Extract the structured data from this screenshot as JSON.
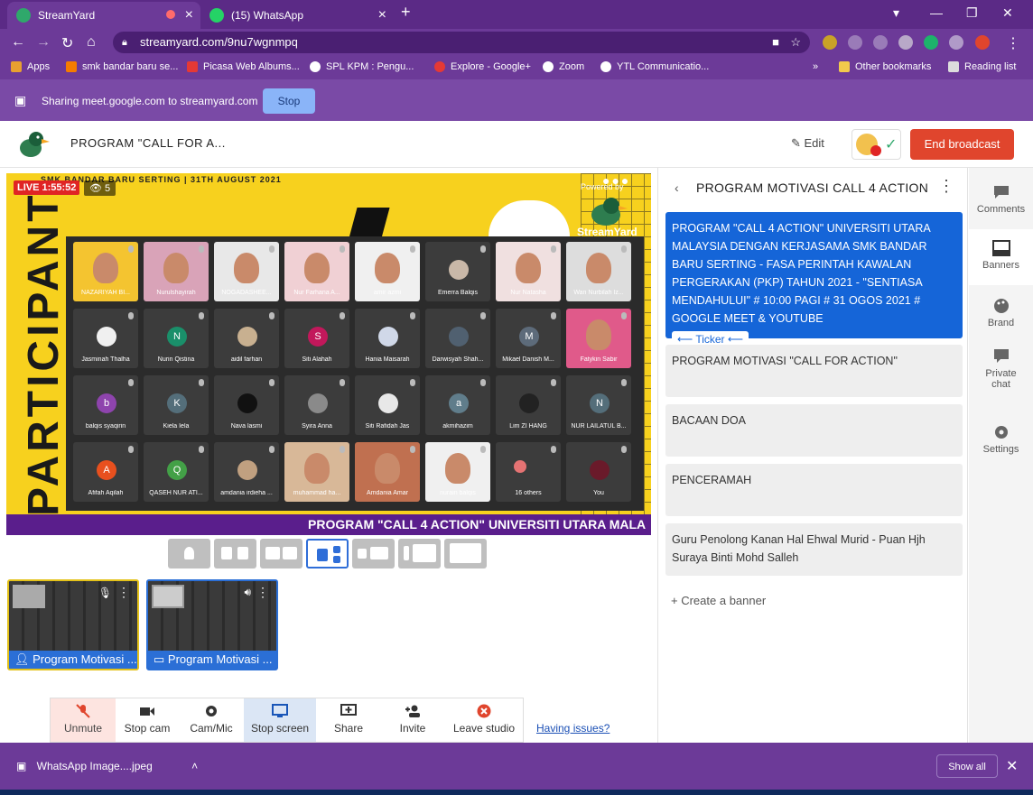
{
  "browser": {
    "tabs": [
      {
        "title": "StreamYard",
        "active": true
      },
      {
        "title": "(15) WhatsApp",
        "active": false
      }
    ],
    "url": "streamyard.com/9nu7wgnmpq",
    "bookmarks": [
      "Apps",
      "smk bandar baru se...",
      "Picasa Web Albums...",
      "SPL KPM : Pengu...",
      "Explore - Google+",
      "Zoom",
      "YTL Communicatio...",
      "»",
      "Other bookmarks",
      "Reading list"
    ],
    "sharing_text": "Sharing meet.google.com to streamyard.com",
    "stop_label": "Stop"
  },
  "header": {
    "title": "PROGRAM \"CALL FOR A...",
    "edit_label": "Edit",
    "end_broadcast_label": "End broadcast"
  },
  "stage": {
    "top_line": "SMK BANDAR BARU SERTING | 31TH AUGUST 2021",
    "live_label": "LIVE 1:55:52",
    "viewers": "5",
    "participant_text": "PARTICIPANT",
    "powered_by": "Powered by",
    "streamyard_label": "StreamYard",
    "ticker_text": "PROGRAM \"CALL 4 ACTION\" UNIVERSITI UTARA MALA",
    "tiles": [
      {
        "name": "NAZARIYAH BI...",
        "kind": "face",
        "color": "#f4c430"
      },
      {
        "name": "Nurulshayirah",
        "kind": "face",
        "color": "#d9a3b8"
      },
      {
        "name": "NOGADASHEE...",
        "kind": "face",
        "color": "#e8e8e8"
      },
      {
        "name": "Nur Farhana A...",
        "kind": "face",
        "color": "#f0d0d4"
      },
      {
        "name": "amir azmi",
        "kind": "face",
        "color": "#f0f0f0"
      },
      {
        "name": "Emerra Balqis",
        "kind": "photo",
        "color": "#c9b8a8"
      },
      {
        "name": "Nur Natasha",
        "kind": "face",
        "color": "#f0e0e0"
      },
      {
        "name": "Wan Nurbilah Iz...",
        "kind": "face",
        "color": "#dddddd"
      },
      {
        "name": "Jasminah Thalha",
        "kind": "photo",
        "color": "#f0f0f0"
      },
      {
        "name": "Nurin Qistina",
        "kind": "letter",
        "letter": "N",
        "color": "#1a8f6a"
      },
      {
        "name": "aidil farhan",
        "kind": "photo",
        "color": "#c8b090"
      },
      {
        "name": "Siti Alahah",
        "kind": "letter",
        "letter": "S",
        "color": "#c2185b"
      },
      {
        "name": "Hania Maisarah",
        "kind": "photo",
        "color": "#d0d8e8"
      },
      {
        "name": "Darwisyah Shah...",
        "kind": "photo",
        "color": "#506070"
      },
      {
        "name": "Mikael Danish M...",
        "kind": "letter",
        "letter": "M",
        "color": "#5d6b7a"
      },
      {
        "name": "Fatykin Sabir",
        "kind": "face",
        "color": "#e05a8a"
      },
      {
        "name": "balqis syaqirin",
        "kind": "letter",
        "letter": "b",
        "color": "#8e44ad"
      },
      {
        "name": "Kiela Iela",
        "kind": "letter",
        "letter": "K",
        "color": "#546e7a"
      },
      {
        "name": "Nava lasmi",
        "kind": "photo",
        "color": "#111111"
      },
      {
        "name": "Syira Anna",
        "kind": "photo",
        "color": "#8a8a8a"
      },
      {
        "name": "Siti Rafidah Jas",
        "kind": "photo",
        "color": "#e8e8e8"
      },
      {
        "name": "akmihazim",
        "kind": "letter",
        "letter": "a",
        "color": "#607d8b"
      },
      {
        "name": "Lim ZI HANG",
        "kind": "photo",
        "color": "#222222"
      },
      {
        "name": "NUR LAILATUL B...",
        "kind": "letter",
        "letter": "N",
        "color": "#546e7a"
      },
      {
        "name": "Afifah Aqilah",
        "kind": "letter",
        "letter": "A",
        "color": "#e8501e"
      },
      {
        "name": "QASEH NUR ATI...",
        "kind": "letter",
        "letter": "Q",
        "color": "#43a047"
      },
      {
        "name": "amdania irdieha ...",
        "kind": "photo",
        "color": "#c0a080"
      },
      {
        "name": "muhammad ha...",
        "kind": "face",
        "color": "#d8b898"
      },
      {
        "name": "Amdania Amar",
        "kind": "face",
        "color": "#c07050"
      },
      {
        "name": "nurain balqis",
        "kind": "face",
        "color": "#f0f0f0"
      },
      {
        "name": "16 others",
        "kind": "others",
        "color": "#3c3c3c"
      },
      {
        "name": "You",
        "kind": "photo",
        "color": "#6a1a2a"
      }
    ]
  },
  "thumbs": [
    {
      "label": "Program Motivasi ..."
    },
    {
      "label": "Program Motivasi ..."
    }
  ],
  "controls": {
    "unmute": "Unmute",
    "stop_cam": "Stop cam",
    "cam_mic": "Cam/Mic",
    "stop_screen": "Stop screen",
    "share": "Share",
    "invite": "Invite",
    "leave": "Leave studio",
    "issues": "Having issues?"
  },
  "panel": {
    "title": "PROGRAM MOTIVASI CALL 4 ACTION",
    "banners": [
      {
        "text": "PROGRAM \"CALL 4 ACTION\" UNIVERSITI UTARA MALAYSIA DENGAN KERJASAMA SMK BANDAR BARU SERTING - FASA PERINTAH KAWALAN PERGERAKAN (PKP) TAHUN 2021 - \"SENTIASA MENDAHULUI\" # 10:00 PAGI # 31 OGOS 2021 # GOOGLE MEET & YOUTUBE",
        "active": true
      },
      {
        "text": "PROGRAM MOTIVASI \"CALL FOR ACTION\"",
        "active": false
      },
      {
        "text": "BACAAN DOA",
        "active": false
      },
      {
        "text": "PENCERAMAH",
        "active": false
      },
      {
        "text": "Guru Penolong Kanan Hal Ehwal Murid - Puan Hjh Suraya Binti Mohd Salleh",
        "active": false
      }
    ],
    "ticker_pill": "⟵ Ticker ⟵",
    "create_banner": "Create a banner"
  },
  "rail": {
    "comments": "Comments",
    "banners": "Banners",
    "brand": "Brand",
    "private_chat": "Private chat",
    "settings": "Settings"
  },
  "download": {
    "file": "WhatsApp Image....jpeg",
    "show_all": "Show all"
  },
  "colors": {
    "chrome_purple": "#6c3a98",
    "stage_yellow": "#f7d11e",
    "end_red": "#e0452d",
    "active_banner": "#1565d8"
  }
}
